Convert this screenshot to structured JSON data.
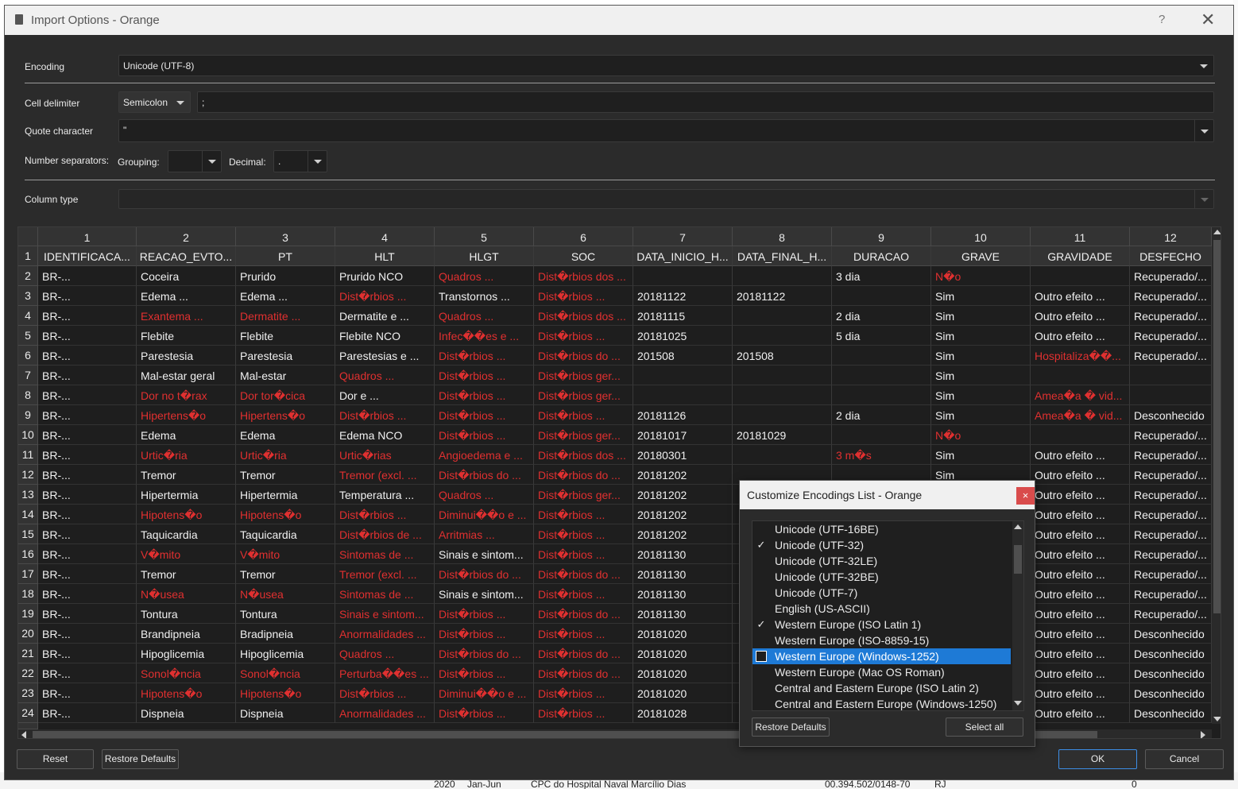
{
  "background": {
    "bottom_fragments": [
      "2020",
      "Jan-Jun",
      "CPC do Hospital Naval Marcílio Dias",
      "00.394.502/0148-70",
      "RJ",
      "0"
    ]
  },
  "window": {
    "title": "Import Options - Orange",
    "help": "?",
    "close": "✕"
  },
  "encoding": {
    "label": "Encoding",
    "value": "Unicode (UTF-8)"
  },
  "cell_delimiter": {
    "label": "Cell delimiter",
    "value": "Semicolon",
    "custom": ";"
  },
  "quote_character": {
    "label": "Quote character",
    "value": "\""
  },
  "number_separators": {
    "label": "Number separators:",
    "grouping_label": "Grouping:",
    "grouping_value": "",
    "decimal_label": "Decimal:",
    "decimal_value": "."
  },
  "column_type": {
    "label": "Column type",
    "value": ""
  },
  "table": {
    "column_numbers": [
      "1",
      "2",
      "3",
      "4",
      "5",
      "6",
      "7",
      "8",
      "9",
      "10",
      "11",
      "12"
    ],
    "header_row_number": "1",
    "headers": [
      "IDENTIFICACA...",
      "REACAO_EVTO...",
      "PT",
      "HLT",
      "HLGT",
      "SOC",
      "DATA_INICIO_H...",
      "DATA_FINAL_H...",
      "DURACAO",
      "GRAVE",
      "GRAVIDADE",
      "DESFECHO"
    ],
    "rows": [
      {
        "n": "2",
        "cells": [
          "BR-...",
          "Coceira",
          "Prurido",
          "Prurido NCO",
          "Quadros ...",
          "Dist�rbios dos ...",
          "",
          "",
          "3 dia",
          "N�o",
          "",
          "Recuperado/..."
        ],
        "red": [
          4,
          5,
          9
        ]
      },
      {
        "n": "3",
        "cells": [
          "BR-...",
          "Edema ...",
          "Edema ...",
          "Dist�rbios ...",
          "Transtornos ...",
          "Dist�rbios ...",
          "20181122",
          "20181122",
          "",
          "Sim",
          "Outro efeito ...",
          "Recuperado/..."
        ],
        "red": [
          3,
          5
        ]
      },
      {
        "n": "4",
        "cells": [
          "BR-...",
          "Exantema ...",
          "Dermatite ...",
          "Dermatite e ...",
          "Quadros ...",
          "Dist�rbios dos ...",
          "20181115",
          "",
          "2 dia",
          "Sim",
          "Outro efeito ...",
          "Recuperado/..."
        ],
        "red": [
          1,
          2,
          4,
          5
        ]
      },
      {
        "n": "5",
        "cells": [
          "BR-...",
          "Flebite",
          "Flebite",
          "Flebite NCO",
          "Infec��es e ...",
          "Dist�rbios ...",
          "20181025",
          "",
          "5 dia",
          "Sim",
          "Outro efeito ...",
          "Recuperado/..."
        ],
        "red": [
          4,
          5
        ]
      },
      {
        "n": "6",
        "cells": [
          "BR-...",
          "Parestesia",
          "Parestesia",
          "Parestesias e ...",
          "Dist�rbios ...",
          "Dist�rbios do ...",
          "201508",
          "201508",
          "",
          "Sim",
          "Hospitaliza��...",
          "Recuperado/..."
        ],
        "red": [
          4,
          5,
          10
        ]
      },
      {
        "n": "7",
        "cells": [
          "BR-...",
          "Mal-estar geral",
          "Mal-estar",
          "Quadros ...",
          "Dist�rbios ...",
          "Dist�rbios ger...",
          "",
          "",
          "",
          "Sim",
          "",
          ""
        ],
        "red": [
          3,
          4,
          5
        ]
      },
      {
        "n": "8",
        "cells": [
          "BR-...",
          "Dor no t�rax",
          "Dor tor�cica",
          "Dor e ...",
          "Dist�rbios ...",
          "Dist�rbios ger...",
          "",
          "",
          "",
          "Sim",
          "Amea�a � vid...",
          ""
        ],
        "red": [
          1,
          2,
          4,
          5,
          10
        ]
      },
      {
        "n": "9",
        "cells": [
          "BR-...",
          "Hipertens�o",
          "Hipertens�o",
          "Dist�rbios ...",
          "Dist�rbios ...",
          "Dist�rbios ...",
          "20181126",
          "",
          "2 dia",
          "Sim",
          "Amea�a � vid...",
          "Desconhecido"
        ],
        "red": [
          1,
          2,
          3,
          4,
          5,
          10
        ]
      },
      {
        "n": "10",
        "cells": [
          "BR-...",
          "Edema",
          "Edema",
          "Edema NCO",
          "Dist�rbios ...",
          "Dist�rbios ger...",
          "20181017",
          "20181029",
          "",
          "N�o",
          "",
          "Recuperado/..."
        ],
        "red": [
          4,
          5,
          9
        ]
      },
      {
        "n": "11",
        "cells": [
          "BR-...",
          "Urtic�ria",
          "Urtic�ria",
          "Urtic�rias",
          "Angioedema e ...",
          "Dist�rbios dos ...",
          "20180301",
          "",
          "3 m�s",
          "Sim",
          "Outro efeito ...",
          "Recuperado/..."
        ],
        "red": [
          1,
          2,
          3,
          4,
          5,
          8
        ]
      },
      {
        "n": "12",
        "cells": [
          "BR-...",
          "Tremor",
          "Tremor",
          "Tremor (excl. ...",
          "Dist�rbios do ...",
          "Dist�rbios do ...",
          "20181202",
          "",
          "",
          "Sim",
          "Outro efeito ...",
          "Recuperado/..."
        ],
        "red": [
          3,
          4,
          5
        ]
      },
      {
        "n": "13",
        "cells": [
          "BR-...",
          "Hipertermia",
          "Hipertermia",
          "Temperatura ...",
          "Quadros ...",
          "Dist�rbios ger...",
          "20181202",
          "",
          "",
          "",
          "Outro efeito ...",
          "Recuperado/..."
        ],
        "red": [
          4,
          5
        ]
      },
      {
        "n": "14",
        "cells": [
          "BR-...",
          "Hipotens�o",
          "Hipotens�o",
          "Dist�rbios ...",
          "Diminui��o e ...",
          "Dist�rbios ...",
          "20181202",
          "",
          "",
          "",
          "Outro efeito ...",
          "Recuperado/..."
        ],
        "red": [
          1,
          2,
          3,
          4,
          5
        ]
      },
      {
        "n": "15",
        "cells": [
          "BR-...",
          "Taquicardia",
          "Taquicardia",
          "Dist�rbios de ...",
          "Arritmias ...",
          "Dist�rbios ...",
          "20181202",
          "",
          "",
          "",
          "Outro efeito ...",
          "Recuperado/..."
        ],
        "red": [
          3,
          4,
          5
        ]
      },
      {
        "n": "16",
        "cells": [
          "BR-...",
          "V�mito",
          "V�mito",
          "Sintomas de ...",
          "Sinais e sintom...",
          "Dist�rbios ...",
          "20181130",
          "",
          "",
          "",
          "Outro efeito ...",
          "Recuperado/..."
        ],
        "red": [
          1,
          2,
          3,
          5
        ]
      },
      {
        "n": "17",
        "cells": [
          "BR-...",
          "Tremor",
          "Tremor",
          "Tremor (excl. ...",
          "Dist�rbios do ...",
          "Dist�rbios do ...",
          "20181130",
          "",
          "",
          "",
          "Outro efeito ...",
          "Recuperado/..."
        ],
        "red": [
          3,
          4,
          5
        ]
      },
      {
        "n": "18",
        "cells": [
          "BR-...",
          "N�usea",
          "N�usea",
          "Sintomas de ...",
          "Sinais e sintom...",
          "Dist�rbios ...",
          "20181130",
          "",
          "",
          "",
          "Outro efeito ...",
          "Recuperado/..."
        ],
        "red": [
          1,
          2,
          3,
          5
        ]
      },
      {
        "n": "19",
        "cells": [
          "BR-...",
          "Tontura",
          "Tontura",
          "Sinais e sintom...",
          "Dist�rbios ...",
          "Dist�rbios do ...",
          "20181130",
          "",
          "",
          "",
          "Outro efeito ...",
          "Recuperado/..."
        ],
        "red": [
          3,
          4,
          5
        ]
      },
      {
        "n": "20",
        "cells": [
          "BR-...",
          "Brandipneia",
          "Bradipneia",
          "Anormalidades ...",
          "Dist�rbios ...",
          "Dist�rbios ...",
          "20181020",
          "",
          "",
          "",
          "Outro efeito ...",
          "Desconhecido"
        ],
        "red": [
          3,
          4,
          5
        ]
      },
      {
        "n": "21",
        "cells": [
          "BR-...",
          "Hipoglicemia",
          "Hipoglicemia",
          "Quadros ...",
          "Dist�rbios do ...",
          "Dist�rbios do ...",
          "20181020",
          "",
          "",
          "",
          "Outro efeito ...",
          "Desconhecido"
        ],
        "red": [
          3,
          4,
          5
        ]
      },
      {
        "n": "22",
        "cells": [
          "BR-...",
          "Sonol�ncia",
          "Sonol�ncia",
          "Perturba��es ...",
          "Dist�rbios ...",
          "Dist�rbios do ...",
          "20181020",
          "",
          "",
          "",
          "Outro efeito ...",
          "Desconhecido"
        ],
        "red": [
          1,
          2,
          3,
          4,
          5
        ]
      },
      {
        "n": "23",
        "cells": [
          "BR-...",
          "Hipotens�o",
          "Hipotens�o",
          "Dist�rbios ...",
          "Diminui��o e ...",
          "Dist�rbios ...",
          "20181020",
          "",
          "",
          "",
          "Outro efeito ...",
          "Desconhecido"
        ],
        "red": [
          1,
          2,
          3,
          4,
          5
        ]
      },
      {
        "n": "24",
        "cells": [
          "BR-...",
          "Dispneia",
          "Dispneia",
          "Anormalidades ...",
          "Dist�rbios ...",
          "Dist�rbios ...",
          "20181028",
          "",
          "",
          "",
          "Outro efeito ...",
          "Desconhecido"
        ],
        "red": [
          3,
          4,
          5
        ]
      }
    ]
  },
  "buttons": {
    "reset": "Reset",
    "restore_defaults": "Restore Defaults",
    "ok": "OK",
    "cancel": "Cancel"
  },
  "encodings_popup": {
    "title": "Customize Encodings List - Orange",
    "close": "×",
    "items": [
      {
        "label": "Unicode (UTF-16BE)",
        "checked": false,
        "selected": false
      },
      {
        "label": "Unicode (UTF-32)",
        "checked": true,
        "selected": false
      },
      {
        "label": "Unicode (UTF-32LE)",
        "checked": false,
        "selected": false
      },
      {
        "label": "Unicode (UTF-32BE)",
        "checked": false,
        "selected": false
      },
      {
        "label": "Unicode (UTF-7)",
        "checked": false,
        "selected": false
      },
      {
        "label": "English (US-ASCII)",
        "checked": false,
        "selected": false
      },
      {
        "label": "Western Europe (ISO Latin 1)",
        "checked": true,
        "selected": false
      },
      {
        "label": "Western Europe (ISO-8859-15)",
        "checked": false,
        "selected": false
      },
      {
        "label": "Western Europe (Windows-1252)",
        "checked": false,
        "selected": true
      },
      {
        "label": "Western Europe (Mac OS Roman)",
        "checked": false,
        "selected": false
      },
      {
        "label": "Central and Eastern Europe (ISO Latin 2)",
        "checked": false,
        "selected": false
      },
      {
        "label": "Central and Eastern Europe (Windows-1250)",
        "checked": false,
        "selected": false
      }
    ],
    "restore_defaults": "Restore Defaults",
    "select_all": "Select all"
  },
  "colors": {
    "accent": "#1e7ad6",
    "invalid_text": "#e03030",
    "popup_close": "#d94c4c"
  }
}
